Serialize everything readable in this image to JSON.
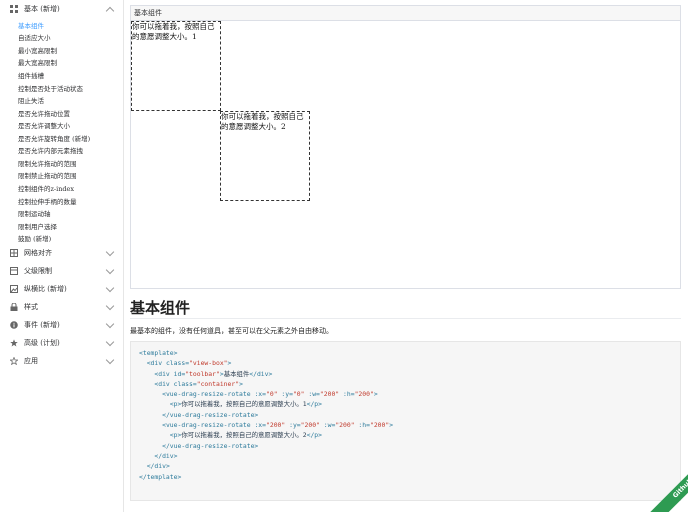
{
  "sidebar": {
    "groups": [
      {
        "label": "基本 (新增)",
        "icon": "grid-icon",
        "expanded": true,
        "items": [
          "基本组件",
          "自适应大小",
          "最小宽高限制",
          "最大宽高限制",
          "组件插槽",
          "控制是否处于活动状态",
          "阻止失活",
          "是否允许拖动位置",
          "是否允许调整大小",
          "是否允许旋转角度 (新增)",
          "是否允许内部元素拖拽",
          "限制允许拖动的范围",
          "限制禁止拖动的范围",
          "控制组件的z-index",
          "控制拉伸手柄的数量",
          "限制运动轴",
          "限制用户选择",
          "鼓励 (新增)"
        ]
      },
      {
        "label": "网格对齐",
        "icon": "grid-table-icon"
      },
      {
        "label": "父级限制",
        "icon": "box-icon"
      },
      {
        "label": "纵横比 (新增)",
        "icon": "picture-icon"
      },
      {
        "label": "样式",
        "icon": "lock-icon"
      },
      {
        "label": "事件 (新增)",
        "icon": "info-icon"
      },
      {
        "label": "高级 (计划)",
        "icon": "star-filled-icon"
      },
      {
        "label": "应用",
        "icon": "star-outline-icon"
      }
    ],
    "active_item": "基本组件"
  },
  "demo": {
    "toolbar": "基本组件",
    "box1_text": "你可以拖着我，按照自己的意愿调整大小。1",
    "box2_text": "你可以拖着我，按照自己的意愿调整大小。2"
  },
  "content": {
    "title": "基本组件",
    "description": "最基本的组件，没有任何道具，甚至可以在父元素之外自由移动。"
  },
  "ribbon": {
    "label": "Github",
    "color": "#2e9b52"
  }
}
